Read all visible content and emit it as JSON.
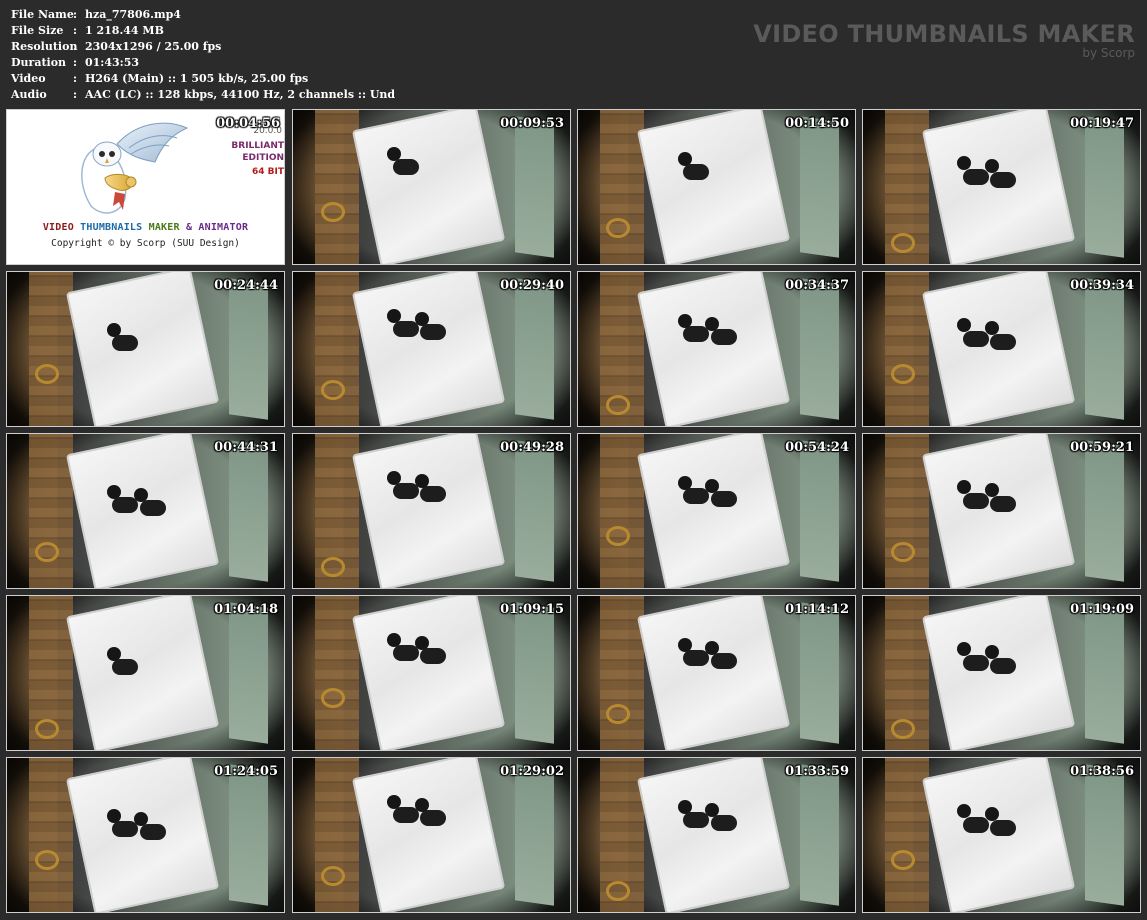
{
  "meta": {
    "rows": [
      {
        "label": "File Name",
        "sep": ":",
        "value": "hza_77806.mp4"
      },
      {
        "label": "File Size",
        "sep": ":",
        "value": "1 218.44 MB"
      },
      {
        "label": "Resolution",
        "sep": ":",
        "value": "2304x1296 / 25.00 fps"
      },
      {
        "label": "Duration",
        "sep": ":",
        "value": "01:43:53"
      },
      {
        "label": "Video",
        "sep": ":",
        "value": "H264 (Main) :: 1 505 kb/s, 25.00 fps"
      },
      {
        "label": "Audio",
        "sep": ":",
        "value": "AAC (LC) :: 128 kbps, 44100 Hz, 2 channels :: Und"
      }
    ]
  },
  "brand": {
    "title": "VIDEO THUMBNAILS MAKER",
    "subtitle": "by Scorp"
  },
  "logo": {
    "timestamp": "00:04:56",
    "version": "20.0.0",
    "edition_line1": "BRILLIANT",
    "edition_line2": "EDITION",
    "bits": "64 BIT",
    "name_w1": "VIDEO",
    "name_w2": "THUMBNAILS",
    "name_w3": "MAKER",
    "name_w4": "& ANIMATOR",
    "copyright": "Copyright © by Scorp (SUU Design)"
  },
  "thumbnails": [
    {
      "timestamp": "00:09:53"
    },
    {
      "timestamp": "00:14:50"
    },
    {
      "timestamp": "00:19:47"
    },
    {
      "timestamp": "00:24:44"
    },
    {
      "timestamp": "00:29:40"
    },
    {
      "timestamp": "00:34:37"
    },
    {
      "timestamp": "00:39:34"
    },
    {
      "timestamp": "00:44:31"
    },
    {
      "timestamp": "00:49:28"
    },
    {
      "timestamp": "00:54:24"
    },
    {
      "timestamp": "00:59:21"
    },
    {
      "timestamp": "01:04:18"
    },
    {
      "timestamp": "01:09:15"
    },
    {
      "timestamp": "01:14:12"
    },
    {
      "timestamp": "01:19:09"
    },
    {
      "timestamp": "01:24:05"
    },
    {
      "timestamp": "01:29:02"
    },
    {
      "timestamp": "01:33:59"
    },
    {
      "timestamp": "01:38:56"
    }
  ],
  "colors": {
    "background": "#2b2b2b",
    "text": "#ffffff",
    "brand": "#5a5a5a",
    "tile_border": "#cfcfcf"
  }
}
